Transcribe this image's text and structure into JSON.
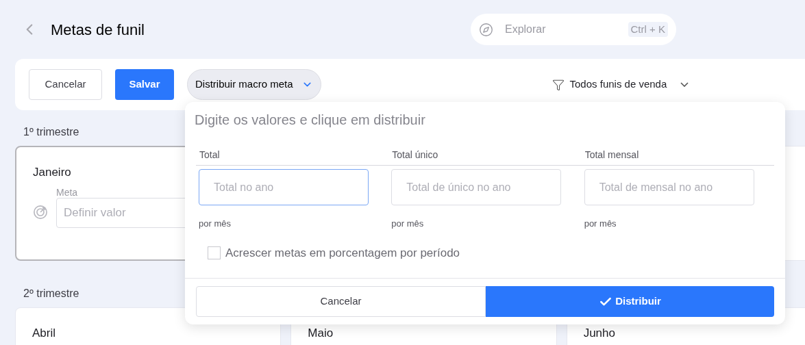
{
  "header": {
    "title": "Metas de funil",
    "search": {
      "placeholder": "Explorar",
      "shortcut": "Ctrl + K"
    }
  },
  "toolbar": {
    "cancel": "Cancelar",
    "save": "Salvar",
    "distribute": "Distribuir macro meta",
    "filter": "Todos funis de venda"
  },
  "quarters": [
    {
      "title": "1º trimestre",
      "months": [
        {
          "name": "Janeiro",
          "selected": true,
          "field_label": "Meta",
          "placeholder": "Definir valor"
        }
      ]
    },
    {
      "title": "2º trimestre",
      "months": [
        {
          "name": "Abril",
          "selected": false
        },
        {
          "name": "Maio",
          "selected": false
        },
        {
          "name": "Junho",
          "selected": false
        }
      ]
    }
  ],
  "popover": {
    "title": "Digite os valores e clique em distribuir",
    "columns": [
      {
        "label": "Total",
        "placeholder": "Total no ano",
        "focused": true,
        "hint": "por mês"
      },
      {
        "label": "Total único",
        "placeholder": "Total de único no ano",
        "focused": false,
        "hint": "por mês"
      },
      {
        "label": "Total mensal",
        "placeholder": "Total de mensal no ano",
        "focused": false,
        "hint": "por mês"
      }
    ],
    "checkbox": {
      "label": "Acrescer metas em porcentagem por período",
      "checked": false
    },
    "cancel": "Cancelar",
    "confirm": "Distribuir"
  }
}
